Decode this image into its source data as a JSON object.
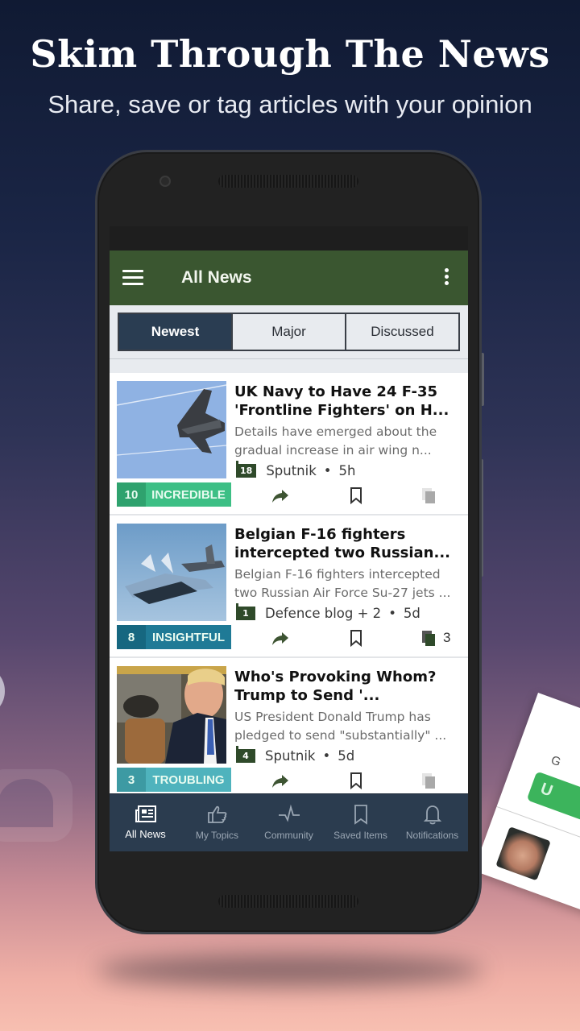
{
  "promo": {
    "headline": "Skim Through The News",
    "subheadline": "Share, save or tag articles with your opinion"
  },
  "app": {
    "title": "All News",
    "tabs": [
      {
        "label": "Newest",
        "active": true
      },
      {
        "label": "Major",
        "active": false
      },
      {
        "label": "Discussed",
        "active": false
      }
    ],
    "articles": [
      {
        "headline": "UK Navy to Have 24 F-35 'Frontline Fighters' on H...",
        "snippet": "Details have emerged about the gradual increase in air wing n...",
        "comments": "18",
        "source": "Sputnik",
        "age": "5h",
        "reaction_count": "10",
        "reaction_label": "INCREDIBLE",
        "reaction_color": "#3dbf85",
        "reaction_count_color": "#2fa26e",
        "copies": "",
        "copies_active": false
      },
      {
        "headline": "Belgian F-16 fighters intercepted two Russian...",
        "snippet": "Belgian F-16 fighters intercepted two Russian Air Force Su-27 jets ...",
        "comments": "1",
        "source": "Defence blog + 2",
        "age": "5d",
        "reaction_count": "8",
        "reaction_label": "INSIGHTFUL",
        "reaction_color": "#1f7a96",
        "reaction_count_color": "#166780",
        "copies": "3",
        "copies_active": true
      },
      {
        "headline": "Who's Provoking Whom? Trump to Send '...",
        "snippet": "US President Donald Trump has pledged to send \"substantially\" ...",
        "comments": "4",
        "source": "Sputnik",
        "age": "5d",
        "reaction_count": "3",
        "reaction_label": "TROUBLING",
        "reaction_color": "#4fb3bd",
        "reaction_count_color": "#3d9aa3",
        "copies": "",
        "copies_active": false
      }
    ],
    "nav": [
      {
        "label": "All News",
        "icon": "newspaper-icon",
        "active": true
      },
      {
        "label": "My Topics",
        "icon": "thumbs-up-icon",
        "active": false
      },
      {
        "label": "Community",
        "icon": "pulse-icon",
        "active": false
      },
      {
        "label": "Saved Items",
        "icon": "bookmark-icon",
        "active": false
      },
      {
        "label": "Notifications",
        "icon": "bell-icon",
        "active": false
      }
    ]
  },
  "side_card": {
    "text_fragment": "G",
    "button_fragment": "U"
  },
  "colors": {
    "appbar": "#3a5630",
    "active_tab": "#2a3d52",
    "navbar": "#2b3c4f",
    "comment_badge": "#2f4a2a"
  }
}
